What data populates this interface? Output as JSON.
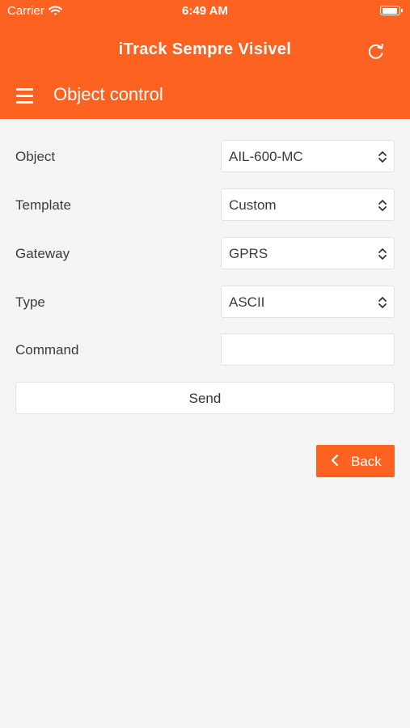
{
  "status_bar": {
    "carrier": "Carrier",
    "time": "6:49 AM",
    "battery_level": 0.95
  },
  "header": {
    "app_title": "iTrack Sempre Visivel",
    "page_title": "Object control",
    "menu_icon": "hamburger-icon",
    "refresh_icon": "refresh-icon"
  },
  "form": {
    "object": {
      "label": "Object",
      "value": "AIL-600-MC"
    },
    "template": {
      "label": "Template",
      "value": "Custom"
    },
    "gateway": {
      "label": "Gateway",
      "value": "GPRS"
    },
    "type": {
      "label": "Type",
      "value": "ASCII"
    },
    "command": {
      "label": "Command",
      "value": ""
    },
    "send_label": "Send"
  },
  "back_label": "Back",
  "colors": {
    "accent": "#fd6220",
    "background": "#f5f5f5"
  }
}
